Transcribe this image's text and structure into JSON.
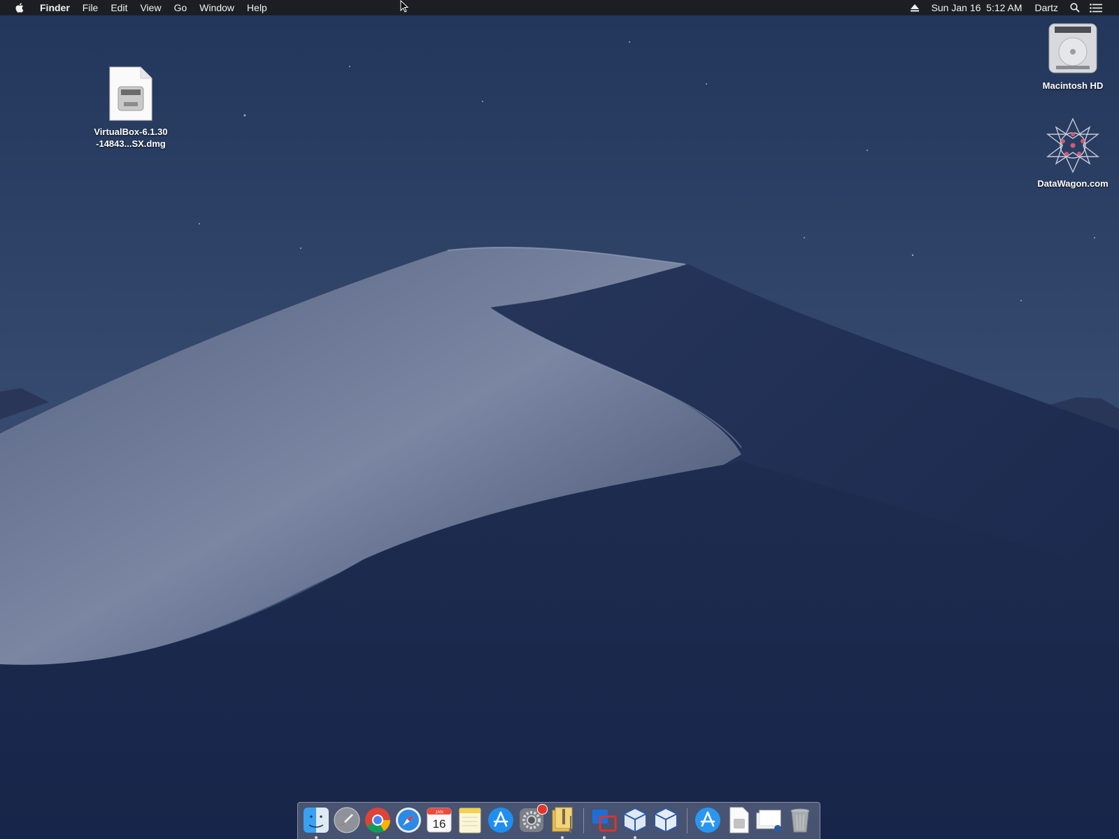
{
  "menubar": {
    "app_name": "Finder",
    "menus": [
      "File",
      "Edit",
      "View",
      "Go",
      "Window",
      "Help"
    ],
    "clock": "Sun Jan 16  5:12 AM",
    "user": "Dartz"
  },
  "desktop": {
    "icons": [
      {
        "line1": "VirtualBox-6.1.30",
        "line2": "-14843...SX.dmg"
      },
      {
        "line1": "Macintosh HD"
      },
      {
        "line1": "DataWagon.com"
      }
    ]
  },
  "dock": {
    "calendar": {
      "month": "JAN",
      "day": "16"
    }
  },
  "colors": {
    "menubar_bg": "#1c1c1e",
    "sky_top": "#2b3f62",
    "sky_bottom": "#3e5678",
    "dune_light": "#6e7b98",
    "dune_dark": "#1a2849",
    "badge": "#e5352b"
  }
}
